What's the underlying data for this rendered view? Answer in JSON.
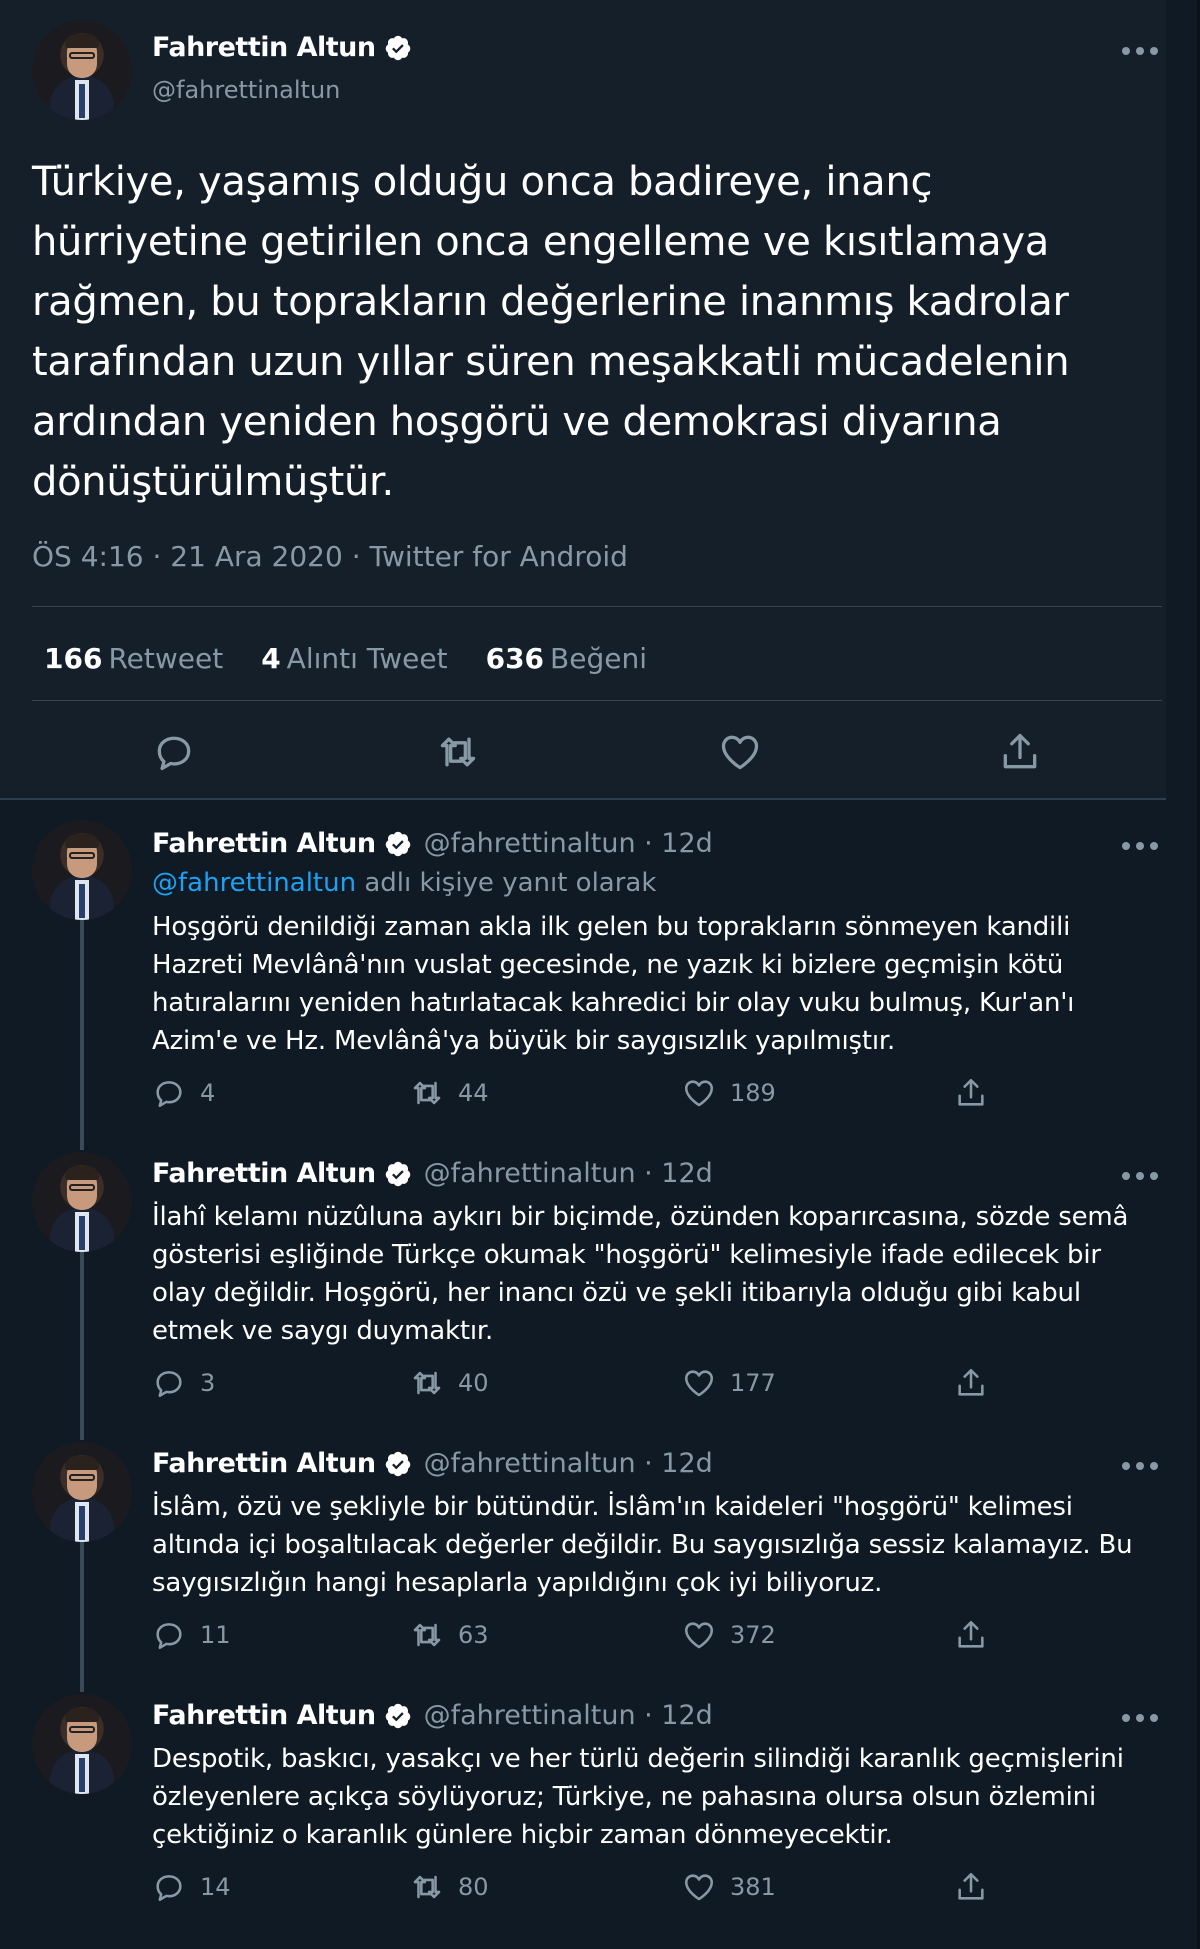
{
  "colors": {
    "background": "#15202b",
    "text": "#ffffff",
    "muted": "#8899a6",
    "accent": "#1da1f2",
    "divider": "#38444d"
  },
  "main_tweet": {
    "author_name": "Fahrettin Altun",
    "handle": "@fahrettinaltun",
    "verified": true,
    "text": "Türkiye, yaşamış olduğu onca badireye, inanç hürriyetine getirilen onca engelleme ve kısıtlamaya rağmen, bu toprakların değerlerine inanmış kadrolar tarafından uzun yıllar süren meşakkatli mücadelenin ardından yeniden hoşgörü ve demokrasi diyarına dönüştürülmüştür.",
    "timestamp": "ÖS 4:16 · 21 Ara 2020 · Twitter for Android",
    "stats": [
      {
        "count": "166",
        "label": "Retweet"
      },
      {
        "count": "4",
        "label": "Alıntı Tweet"
      },
      {
        "count": "636",
        "label": "Beğeni"
      }
    ],
    "actions": [
      "reply-icon",
      "retweet-icon",
      "like-icon",
      "share-icon"
    ]
  },
  "replies": [
    {
      "author_name": "Fahrettin Altun",
      "handle_time": "@fahrettinaltun · 12d",
      "replying_mention": "@fahrettinaltun",
      "replying_suffix": " adlı kişiye yanıt olarak",
      "text": "Hoşgörü denildiği zaman akla ilk gelen bu toprakların sönmeyen kandili Hazreti Mevlânâ'nın vuslat gecesinde, ne yazık ki bizlere geçmişin kötü hatıralarını yeniden hatırlatacak kahredici bir olay vuku bulmuş, Kur'an'ı Azim'e ve Hz. Mevlânâ'ya büyük bir saygısızlık yapılmıştır.",
      "replies": "4",
      "retweets": "44",
      "likes": "189"
    },
    {
      "author_name": "Fahrettin Altun",
      "handle_time": "@fahrettinaltun · 12d",
      "text": "İlahî kelamı nüzûluna aykırı bir biçimde, özünden koparırcasına, sözde semâ gösterisi eşliğinde Türkçe okumak \"hoşgörü\" kelimesiyle ifade edilecek bir olay değildir. Hoşgörü, her inancı özü ve şekli itibarıyla olduğu gibi kabul etmek ve saygı duymaktır.",
      "replies": "3",
      "retweets": "40",
      "likes": "177"
    },
    {
      "author_name": "Fahrettin Altun",
      "handle_time": "@fahrettinaltun · 12d",
      "text": "İslâm, özü ve şekliyle bir bütündür. İslâm'ın kaideleri \"hoşgörü\" kelimesi altında içi boşaltılacak değerler değildir. Bu saygısızlığa  sessiz kalamayız. Bu saygısızlığın hangi hesaplarla yapıldığını çok iyi biliyoruz.",
      "replies": "11",
      "retweets": "63",
      "likes": "372"
    },
    {
      "author_name": "Fahrettin Altun",
      "handle_time": "@fahrettinaltun · 12d",
      "text": "Despotik, baskıcı, yasakçı ve her türlü değerin silindiği karanlık geçmişlerini özleyenlere açıkça söylüyoruz; Türkiye, ne pahasına olursa olsun özlemini çektiğiniz o karanlık günlere hiçbir zaman dönmeyecektir.",
      "replies": "14",
      "retweets": "80",
      "likes": "381"
    }
  ]
}
